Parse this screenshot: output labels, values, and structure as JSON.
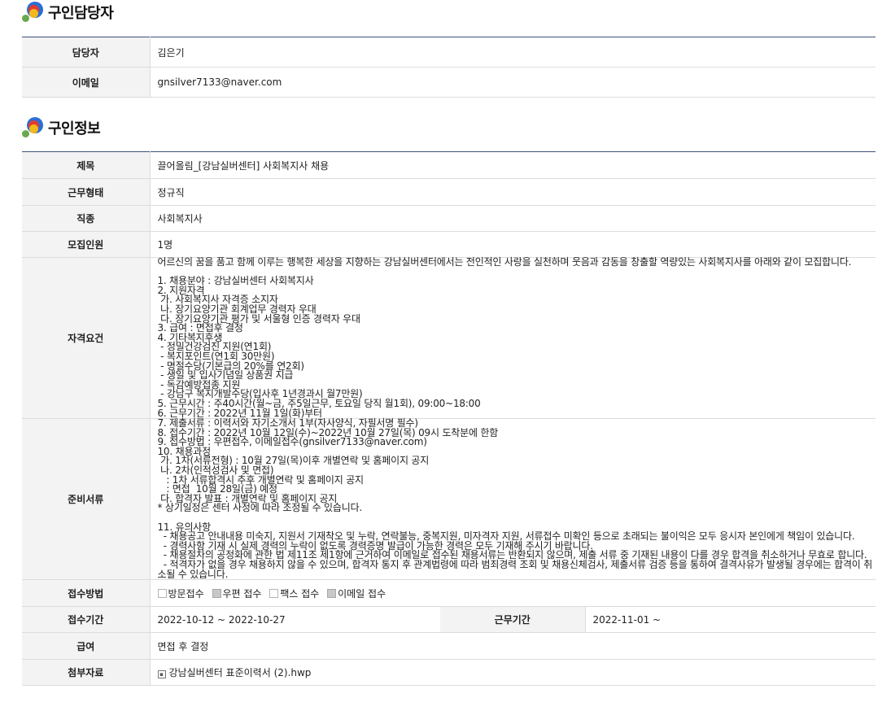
{
  "manager_section": {
    "title": "구인담당자",
    "rows": [
      {
        "label": "담당자",
        "value": "김은기"
      },
      {
        "label": "이메일",
        "value": "gnsilver7133@naver.com"
      }
    ]
  },
  "job_section": {
    "title": "구인정보",
    "title_row": {
      "label": "제목",
      "value": "끌어올림_[강남실버센터] 사회복지사 채용"
    },
    "employment_type": {
      "label": "근무형태",
      "value": "정규직"
    },
    "job_type": {
      "label": "직종",
      "value": "사회복지사"
    },
    "headcount": {
      "label": "모집인원",
      "value": "1명"
    },
    "qualifications": {
      "label": "자격요건",
      "text": "어르신의 꿈을 품고 함께 이루는 행복한 세상을 지향하는 강남실버센터에서는 전인적인 사랑을 실천하며 웃음과 감동을 창출할 역량있는 사회복지사를 아래와 같이 모집합니다.\n\n1. 채용분야 : 강남실버센터 사회복지사\n2. 지원자격\n 가. 사회복지사 자격증 소지자\n 나. 장기요양기관 회계업무 경력자 우대\n 다. 장기요양기관 평가 및 서울형 인증 경력자 우대\n3. 급여 : 면접후 결정\n4. 기타복지후생\n - 정밀건강검진 지원(연1회)\n - 복지포인트(연1회 30만원)\n - 명절수당(기본급의 20%를 연2회)\n - 생일 및 입사기념일 상품권 지급\n - 독감예방접종 지원\n - 강남구 복지개발수당(입사후 1년경과시 월7만원)\n5. 근무시간 : 주40시간(월~금, 주5일근무, 토요일 당직 월1회), 09:00~18:00\n6. 근무기간 : 2022년 11월 1일(화)부터"
    },
    "documents": {
      "label": "준비서류",
      "text": "7. 제출서류 : 이력서와 자기소개서 1부(자사양식, 자필서명 필수)\n8. 접수기간 : 2022년 10월 12일(수)~2022년 10월 27일(목) 09시 도착분에 한함\n9. 접수방법 : 우편접수, 이메일접수(gnsilver7133@naver.com)\n10. 채용과정\n 가. 1차(서류전형) : 10월 27일(목)이후 개별연락 및 홈페이지 공지\n 나. 2차(인적성검사 및 면접)\n   : 1차 서류합격시 추후 개별연락 및 홈페이지 공지\n   : 면접  10월 28일(금) 예정\n 다. 합격자 발표 : 개별연락 및 홈페이지 공지\n* 상기일정은 센터 사정에 따라 조정될 수 있습니다.\n\n11. 유의사항\n  - 채용공고 안내내용 미숙지, 지원서 기재착오 및 누락, 연락불능, 중복지원, 미자격자 지원, 서류접수 미확인 등으로 초래되는 불이익은 모두 응시자 본인에게 책임이 있습니다.\n  - 경력사항 기재 시 실제 경력의 누락이 없도록 경력증명 발급이 가능한 경력은 모두 기재해 주시기 바랍니다.\n  - 채용절차의 공정화에 관한 법 제11조 제1항에 근거하여 이메일로 접수된 채용서류는 반환되지 않으며, 제출 서류 중 기재된 내용이 다를 경우 합격을 취소하거나 무효로 합니다.\n  - 적격자가 없을 경우 채용하지 않을 수 있으며, 합격자 통지 후 관계법령에 따라 범죄경력 조회 및 채용신체검사, 제출서류 검증 등을 통하여 결격사유가 발생될 경우에는 합격이 취소될 수 있습니다."
    },
    "application_method": {
      "label": "접수방법",
      "options": [
        {
          "label": "방문접수",
          "checked": false
        },
        {
          "label": "우편 접수",
          "checked": true
        },
        {
          "label": "팩스 접수",
          "checked": false
        },
        {
          "label": "이메일 접수",
          "checked": true
        }
      ]
    },
    "application_period": {
      "label": "접수기간",
      "value": "2022-10-12 ~ 2022-10-27"
    },
    "work_period": {
      "label": "근무기간",
      "value": "2022-11-01 ~"
    },
    "salary": {
      "label": "급여",
      "value": "면접 후 결정"
    },
    "attachment": {
      "label": "첨부자료",
      "icon": "file-icon",
      "filename": "강남실버센터 표준이력서 (2).hwp"
    }
  }
}
